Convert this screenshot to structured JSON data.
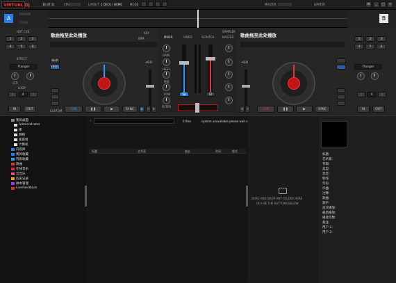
{
  "topbar": {
    "logo": "VIRTUAL DJ",
    "clock": "16:47:11",
    "cpu_label": "CPU",
    "layout_label": "LAYOUT",
    "layout_value": "2 DECK / HOME",
    "mode_label": "MODE",
    "master_label": "MASTER",
    "limiter_label": "LIMITER"
  },
  "deckA": {
    "letter": "A",
    "header_small": "REMAIN",
    "header_total": "TOTAL",
    "title": "歌曲拖至此处播放",
    "key_label": "KEY",
    "pitch_label": "PITCH",
    "bpm_label": "BPM",
    "hotcue_label": "HOT CUE",
    "effect_label": "EFFECT",
    "effect_value": "Flanger",
    "str_label": "STR",
    "loop_label": "LOOP",
    "pitch_value": "+0.0",
    "buttons": {
      "cue": "CUE",
      "play": "▶",
      "sync": "SYNC",
      "in": "IN",
      "out": "OUT",
      "slip": "SLIP",
      "vinyl": "VINYL",
      "custom": "CUSTOM",
      "loop_size": "4"
    },
    "hotcues": [
      "1",
      "2",
      "3",
      "4",
      "5",
      "6",
      "7",
      "8"
    ]
  },
  "deckB": {
    "letter": "B",
    "title": "歌曲拖至此处播放",
    "effect_value": "Flanger",
    "pitch_value": "+0.0",
    "buttons": {
      "cue": "CUE",
      "play": "▶",
      "sync": "SYNC",
      "in": "IN",
      "out": "OUT"
    }
  },
  "mixer": {
    "tabs": [
      "MIXER",
      "VIDEO",
      "SCRATCH",
      "MASTER"
    ],
    "sampler_label": "SAMPLER",
    "eq_labels": [
      "HIGH",
      "MID",
      "LOW",
      "FILTER"
    ],
    "gain_label": "GAIN"
  },
  "browser": {
    "search_placeholder": "",
    "file_count": "0 files",
    "status_text": "system unavailable please wait or cre...",
    "columns": [
      "标题",
      "艺术家",
      "曲长",
      "时间",
      "格式"
    ],
    "drop_line1": "DRAG AND DROP ANY FOLDER HERE",
    "drop_line2": "OR USE THE BUTTONS BELOW"
  },
  "tree": [
    {
      "label": "我的桌面",
      "color": "#888"
    },
    {
      "label": "Administrator",
      "color": "#ddd"
    },
    {
      "label": "库",
      "color": "#ddd"
    },
    {
      "label": "网络",
      "color": "#ddd"
    },
    {
      "label": "家庭组",
      "color": "#ddd"
    },
    {
      "label": "计算机",
      "color": "#ddd"
    },
    {
      "label": "内容库",
      "color": "#2a7de1"
    },
    {
      "label": "我的收藏",
      "color": "#2a7de1"
    },
    {
      "label": "列表收藏",
      "color": "#2aa3d4"
    },
    {
      "label": "歌曲",
      "color": "#d43a3a"
    },
    {
      "label": "在线音乐",
      "color": "#c33"
    },
    {
      "label": "云音乐",
      "color": "#e04c8a"
    },
    {
      "label": "历史记录",
      "color": "#d4a42a"
    },
    {
      "label": "样本管理",
      "color": "#8a44d4"
    },
    {
      "label": "LiveFeedback",
      "color": "#c33"
    }
  ],
  "info": {
    "fields": [
      "标题:",
      "艺术家:",
      "专辑:",
      "类型:",
      "混音:",
      "制作:",
      "年份:",
      "作曲:",
      "注释:",
      "歌曲:",
      "歌手:",
      "首次播放:",
      "最后播放:",
      "播放次数:",
      "备注:",
      "用户 1:",
      "用户 2:"
    ]
  }
}
